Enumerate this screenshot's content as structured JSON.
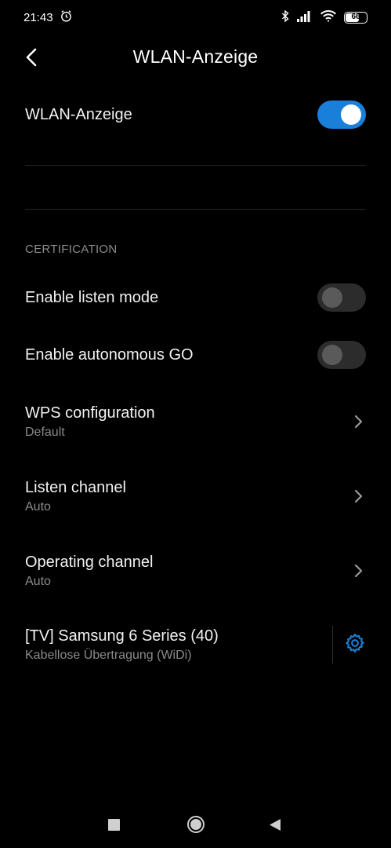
{
  "status_bar": {
    "time": "21:43",
    "battery_level": "66",
    "battery_fraction": 0.66
  },
  "header": {
    "title": "WLAN-Anzeige"
  },
  "main_toggle": {
    "label": "WLAN-Anzeige",
    "state": "on"
  },
  "certification": {
    "section_title": "CERTIFICATION",
    "listen_mode": {
      "label": "Enable listen mode",
      "state": "off"
    },
    "autonomous_go": {
      "label": "Enable autonomous GO",
      "state": "off"
    },
    "wps": {
      "label": "WPS configuration",
      "value": "Default"
    },
    "listen_channel": {
      "label": "Listen channel",
      "value": "Auto"
    },
    "operating_channel": {
      "label": "Operating channel",
      "value": "Auto"
    }
  },
  "device": {
    "name": "[TV] Samsung 6 Series (40)",
    "status": "Kabellose Übertragung (WiDi)"
  },
  "colors": {
    "accent": "#1a7fd8",
    "background": "#000000",
    "secondary_text": "#8a8a8a"
  },
  "icons": {
    "back": "chevron-left-icon",
    "settings": "gear-icon",
    "alarm": "alarm-clock-icon",
    "bluetooth": "bluetooth-icon",
    "signal": "cellular-signal-icon",
    "wifi": "wifi-icon"
  }
}
